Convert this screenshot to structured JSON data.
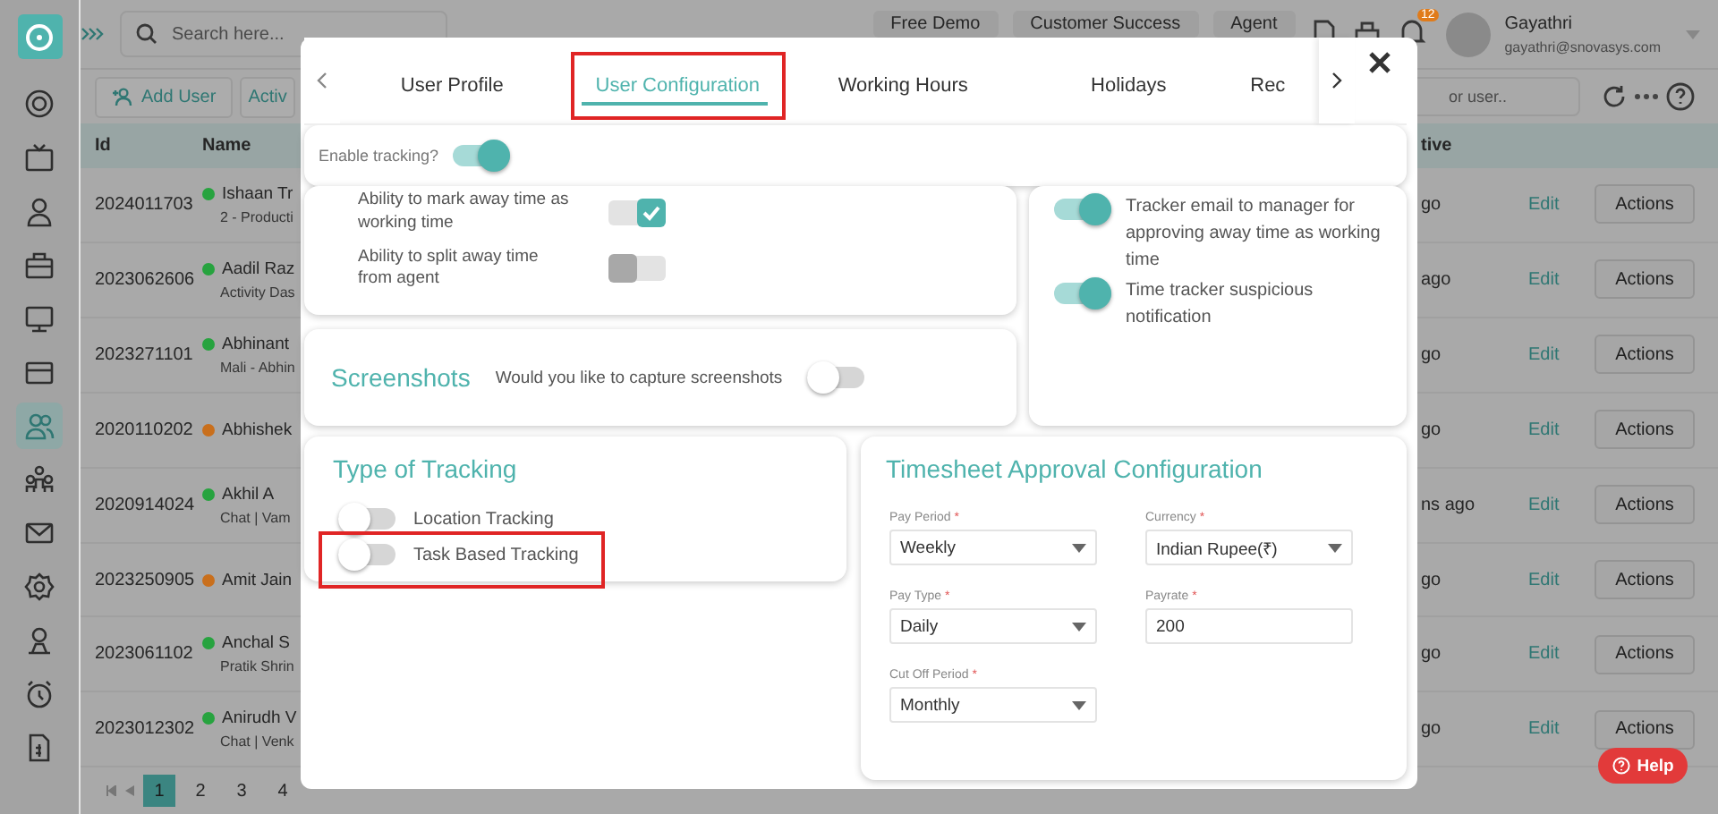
{
  "topbar": {
    "search_placeholder": "Search here...",
    "buttons": [
      "Free Demo",
      "Customer Success",
      "Agent"
    ],
    "notification_count": "12",
    "user": {
      "name": "Gayathri",
      "email": "gayathri@snovasys.com"
    }
  },
  "sidebar": {
    "items": [
      {
        "selected": false
      },
      {
        "selected": false
      },
      {
        "selected": false
      },
      {
        "selected": false
      },
      {
        "selected": false
      },
      {
        "selected": false
      },
      {
        "selected": true
      },
      {
        "selected": false
      },
      {
        "selected": false
      },
      {
        "selected": false
      },
      {
        "selected": false
      },
      {
        "selected": false
      },
      {
        "selected": false
      }
    ]
  },
  "toolbar": {
    "add_button": "Add User",
    "filter": "Activ",
    "search_placeholder": "or user.."
  },
  "table": {
    "columns": [
      "Id",
      "Name",
      "tive"
    ],
    "rows": [
      {
        "id": "2024011703",
        "color": "#27a33f",
        "name": "Ishaan Tr",
        "detail": "2 - Producti",
        "last_active": "go",
        "edit": "Edit",
        "action": "Actions"
      },
      {
        "id": "2023062606",
        "color": "#27a33f",
        "name": "Aadil Raz",
        "detail": "Activity Das",
        "last_active": "ago",
        "edit": "Edit",
        "action": "Actions"
      },
      {
        "id": "2023271101",
        "color": "#27a33f",
        "name": "Abhinant",
        "detail": "Mali - Abhin",
        "last_active": "go",
        "edit": "Edit",
        "action": "Actions"
      },
      {
        "id": "2020110202",
        "color": "#c96f1c",
        "name": "Abhishek",
        "last_active": "go",
        "edit": "Edit",
        "action": "Actions"
      },
      {
        "id": "2020914024",
        "color": "#27a33f",
        "name": "Akhil A",
        "detail": "Chat | Vam",
        "last_active": "ns ago",
        "edit": "Edit",
        "action": "Actions"
      },
      {
        "id": "2023250905",
        "color": "#c96f1c",
        "name": "Amit Jain",
        "last_active": "go",
        "edit": "Edit",
        "action": "Actions"
      },
      {
        "id": "2023061102",
        "color": "#27a33f",
        "name": "Anchal S",
        "detail": "Pratik Shrin",
        "last_active": "go",
        "edit": "Edit",
        "action": "Actions"
      },
      {
        "id": "2023012302",
        "color": "#27a33f",
        "name": "Anirudh V",
        "detail": "Chat | Venk",
        "last_active": "go",
        "edit": "Edit",
        "action": "Actions"
      }
    ]
  },
  "pagination": {
    "pages": [
      {
        "label": "1",
        "selected": true
      },
      {
        "label": "2",
        "selected": false
      },
      {
        "label": "3",
        "selected": false
      },
      {
        "label": "4",
        "selected": false
      }
    ]
  },
  "modal": {
    "tabs": [
      {
        "label": "User Profile",
        "selected": false,
        "highlighted": false
      },
      {
        "label": "User Configuration",
        "selected": true,
        "highlighted": true
      },
      {
        "label": "Working Hours",
        "selected": false,
        "highlighted": false
      },
      {
        "label": "Holidays",
        "selected": false,
        "highlighted": false
      },
      {
        "label": "Rec",
        "selected": false,
        "highlighted": false
      }
    ],
    "enable_tracking": {
      "label": "Enable tracking?",
      "on": true
    },
    "away_settings": [
      {
        "label": "Ability to mark away time as working time",
        "checked": true
      },
      {
        "label": "Ability to split away time from agent",
        "checked": false
      }
    ],
    "manager_settings": [
      {
        "label": "Tracker email to manager for approving away time as working time",
        "on": true
      },
      {
        "label": "Time tracker suspicious notification",
        "on": true
      }
    ],
    "screenshots": {
      "title": "Screenshots",
      "label": "Would you like to capture screenshots",
      "on": false
    },
    "tracking_types": {
      "title": "Type of Tracking",
      "items": [
        {
          "label": "Location Tracking",
          "on": false,
          "highlighted": false
        },
        {
          "label": "Task Based Tracking",
          "on": false,
          "highlighted": true
        }
      ]
    },
    "timesheet": {
      "title": "Timesheet Approval Configuration",
      "fields": [
        {
          "kind": "select",
          "label": "Pay Period",
          "required_mark": "*",
          "value": "Weekly"
        },
        {
          "kind": "select",
          "label": "Currency",
          "required_mark": "*",
          "value": "Indian Rupee(₹)"
        },
        {
          "kind": "select",
          "label": "Pay Type",
          "required_mark": "*",
          "value": "Daily"
        },
        {
          "kind": "input",
          "label": "Payrate",
          "required_mark": "*",
          "value": "200"
        },
        {
          "kind": "select",
          "label": "Cut Off Period",
          "required_mark": "*",
          "value": "Monthly"
        }
      ]
    }
  },
  "help_button": "Help"
}
